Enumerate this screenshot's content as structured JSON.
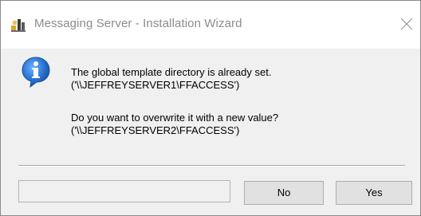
{
  "window": {
    "title": "Messaging Server - Installation Wizard",
    "close_glyph": "✕"
  },
  "message": {
    "line1": "The global template directory is already set.",
    "line2": "('\\\\JEFFREYSERVER1\\FFACCESS')",
    "line3": "Do you want to overwrite it with a new value?",
    "line4": "('\\\\JEFFREYSERVER2\\FFACCESS')"
  },
  "buttons": {
    "no_label": "No",
    "yes_label": "Yes"
  },
  "progress": {
    "value": 0
  },
  "icons": {
    "app": "installer-wizard-icon",
    "message": "info-icon",
    "close": "close-icon"
  },
  "colors": {
    "info_blue": "#1f5fb5",
    "title_text": "#8c8c8c",
    "button_face": "#e1e1e1",
    "dialog_face": "#f0f0f0"
  }
}
